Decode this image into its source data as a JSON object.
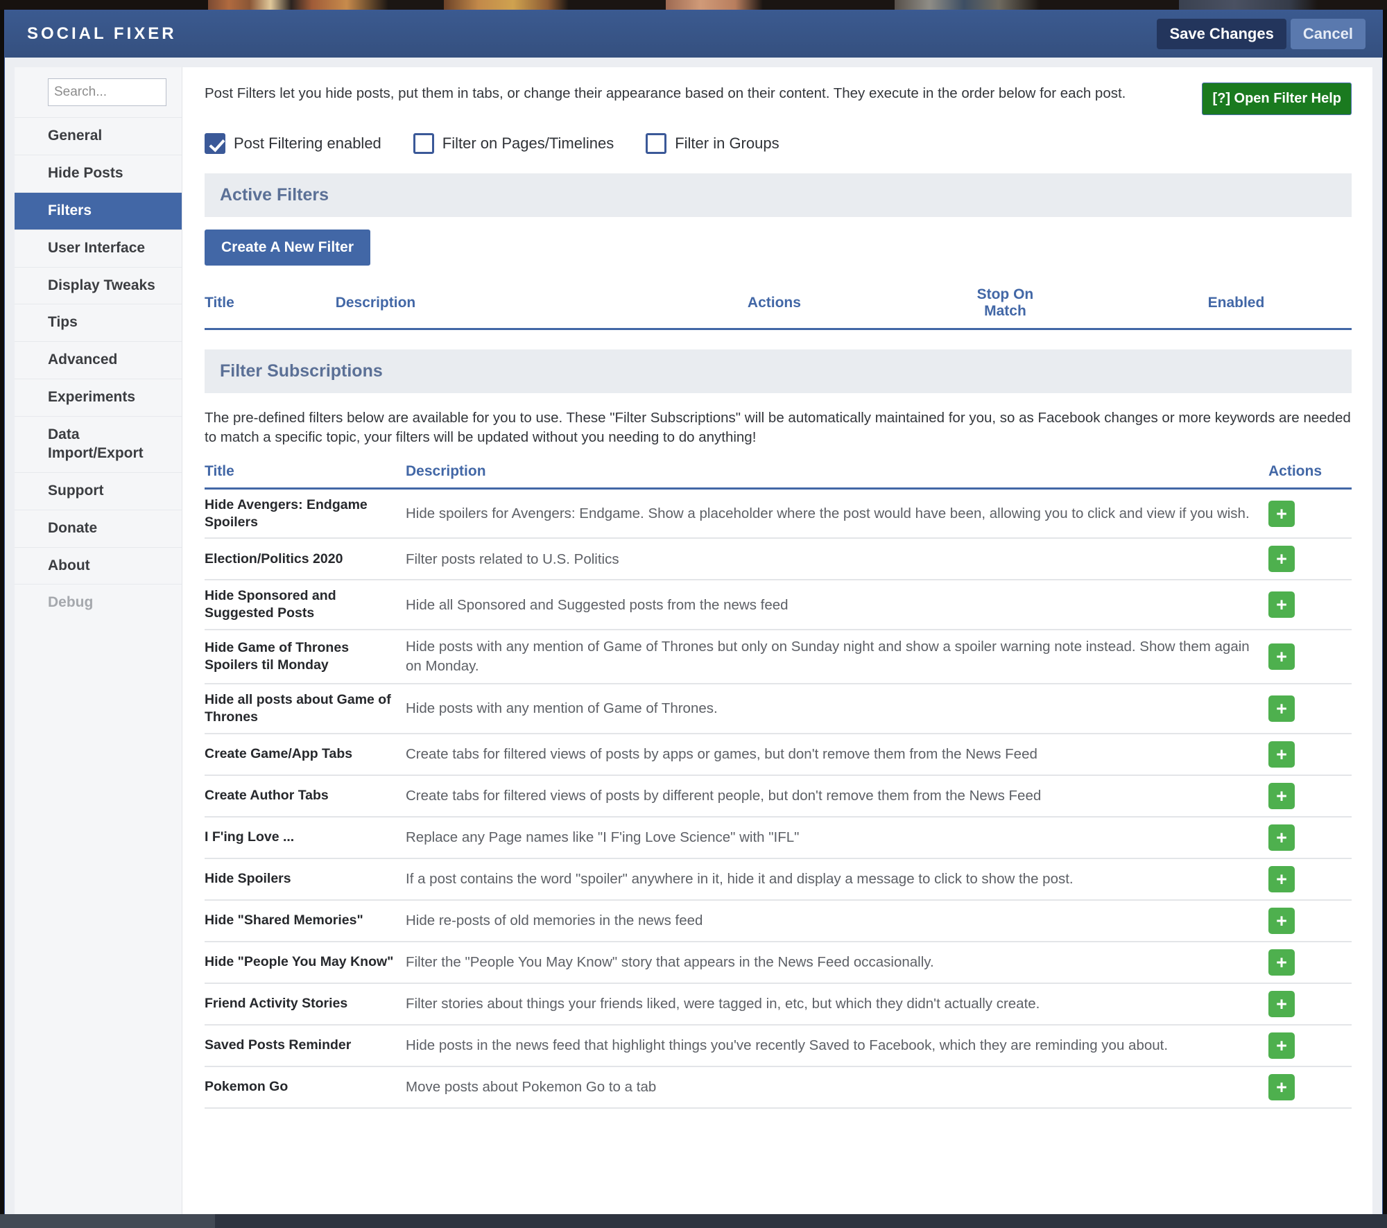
{
  "titlebar": {
    "app_title": "SOCIAL FIXER",
    "save_label": "Save Changes",
    "cancel_label": "Cancel"
  },
  "sidebar": {
    "search_placeholder": "Search...",
    "search_value": "",
    "items": [
      {
        "label": "General",
        "state": "normal"
      },
      {
        "label": "Hide Posts",
        "state": "normal"
      },
      {
        "label": "Filters",
        "state": "selected"
      },
      {
        "label": "User Interface",
        "state": "normal"
      },
      {
        "label": "Display Tweaks",
        "state": "normal"
      },
      {
        "label": "Tips",
        "state": "normal"
      },
      {
        "label": "Advanced",
        "state": "normal"
      },
      {
        "label": "Experiments",
        "state": "normal"
      },
      {
        "label": "Data Import/Export",
        "state": "normal"
      },
      {
        "label": "Support",
        "state": "normal"
      },
      {
        "label": "Donate",
        "state": "normal"
      },
      {
        "label": "About",
        "state": "normal"
      },
      {
        "label": "Debug",
        "state": "disabled"
      }
    ]
  },
  "main": {
    "intro_text": "Post Filters let you hide posts, put them in tabs, or change their appearance based on their content. They execute in the order below for each post.",
    "help_button_label": "[?] Open Filter Help",
    "checkboxes": [
      {
        "label": "Post Filtering enabled",
        "checked": true
      },
      {
        "label": "Filter on Pages/Timelines",
        "checked": false
      },
      {
        "label": "Filter in Groups",
        "checked": false
      }
    ],
    "active_filters": {
      "section_title": "Active Filters",
      "create_button_label": "Create A New Filter",
      "columns": [
        "Title",
        "Description",
        "Actions",
        "Stop On Match",
        "Enabled"
      ],
      "rows": []
    },
    "subscriptions": {
      "section_title": "Filter Subscriptions",
      "intro_text": "The pre-defined filters below are available for you to use. These \"Filter Subscriptions\" will be automatically maintained for you, so as Facebook changes or more keywords are needed to match a specific topic, your filters will be updated without you needing to do anything!",
      "columns": [
        "Title",
        "Description",
        "Actions"
      ],
      "add_icon_label": "+",
      "rows": [
        {
          "title": "Hide Avengers: Endgame Spoilers",
          "description": "Hide spoilers for Avengers: Endgame. Show a placeholder where the post would have been, allowing you to click and view if you wish."
        },
        {
          "title": "Election/Politics 2020",
          "description": "Filter posts related to U.S. Politics"
        },
        {
          "title": "Hide Sponsored and Suggested Posts",
          "description": "Hide all Sponsored and Suggested posts from the news feed"
        },
        {
          "title": "Hide Game of Thrones Spoilers til Monday",
          "description": "Hide posts with any mention of Game of Thrones but only on Sunday night and show a spoiler warning note instead. Show them again on Monday."
        },
        {
          "title": "Hide all posts about Game of Thrones",
          "description": "Hide posts with any mention of Game of Thrones."
        },
        {
          "title": "Create Game/App Tabs",
          "description": "Create tabs for filtered views of posts by apps or games, but don't remove them from the News Feed"
        },
        {
          "title": "Create Author Tabs",
          "description": "Create tabs for filtered views of posts by different people, but don't remove them from the News Feed"
        },
        {
          "title": "I F'ing Love ...",
          "description": "Replace any Page names like \"I F'ing Love Science\" with \"IFL\""
        },
        {
          "title": "Hide Spoilers",
          "description": "If a post contains the word \"spoiler\" anywhere in it, hide it and display a message to click to show the post."
        },
        {
          "title": "Hide \"Shared Memories\"",
          "description": "Hide re-posts of old memories in the news feed"
        },
        {
          "title": "Hide \"People You May Know\"",
          "description": "Filter the \"People You May Know\" story that appears in the News Feed occasionally."
        },
        {
          "title": "Friend Activity Stories",
          "description": "Filter stories about things your friends liked, were tagged in, etc, but which they didn't actually create."
        },
        {
          "title": "Saved Posts Reminder",
          "description": "Hide posts in the news feed that highlight things you've recently Saved to Facebook, which they are reminding you about."
        },
        {
          "title": "Pokemon Go",
          "description": "Move posts about Pokemon Go to a tab"
        }
      ]
    }
  },
  "colors": {
    "brand_blue": "#3b5998",
    "accent_blue": "#4267a6",
    "add_green": "#4eb04e",
    "help_green": "#1a7a1f"
  }
}
